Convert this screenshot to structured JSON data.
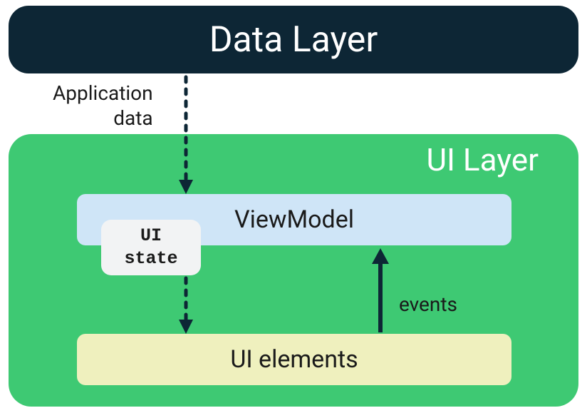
{
  "diagram": {
    "data_layer": "Data Layer",
    "ui_layer": "UI Layer",
    "viewmodel": "ViewModel",
    "ui_state": "UI\nstate",
    "ui_elements": "UI elements",
    "labels": {
      "application_data": "Application\ndata",
      "events": "events"
    },
    "colors": {
      "data_layer_bg": "#0d2635",
      "ui_layer_bg": "#3ec973",
      "viewmodel_bg": "#cfe5f7",
      "ui_state_bg": "#f2f3f4",
      "ui_elements_bg": "#eff0be",
      "arrow": "#0d2635"
    }
  }
}
